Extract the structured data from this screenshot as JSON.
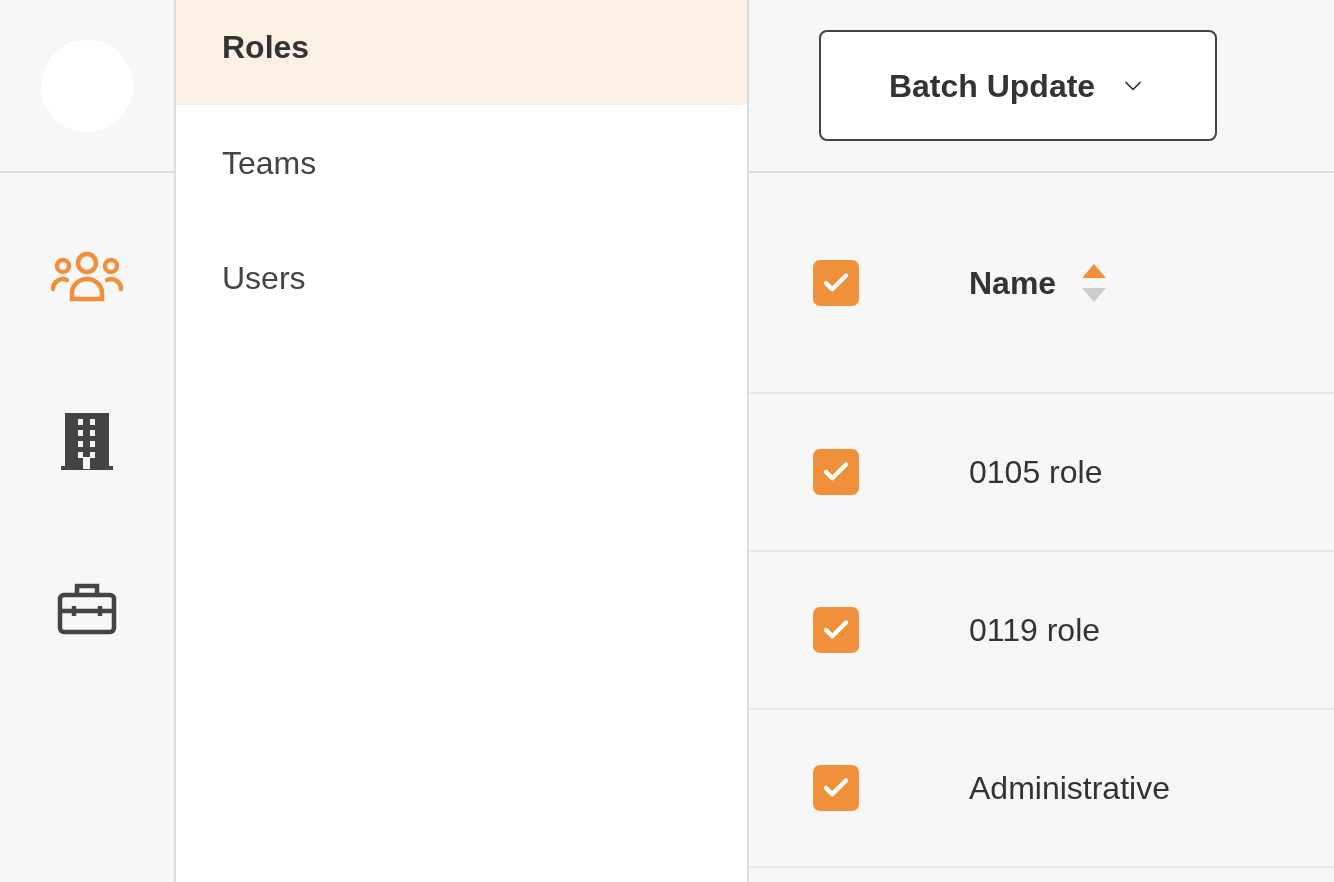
{
  "rail": {
    "items": [
      {
        "kind": "people",
        "selected": true
      },
      {
        "kind": "building",
        "selected": false
      },
      {
        "kind": "toolbox",
        "selected": false
      }
    ]
  },
  "menu": {
    "items": [
      {
        "label": "Roles",
        "selected": true
      },
      {
        "label": "Teams",
        "selected": false
      },
      {
        "label": "Users",
        "selected": false
      }
    ]
  },
  "toolbar": {
    "batch_button": "Batch Update"
  },
  "table": {
    "header": {
      "checked": true,
      "label": "Name",
      "sort_ascending": true
    },
    "rows": [
      {
        "name": "0105 role",
        "checked": true
      },
      {
        "name": "0119 role",
        "checked": true
      },
      {
        "name": "Administrative",
        "checked": true
      }
    ]
  }
}
